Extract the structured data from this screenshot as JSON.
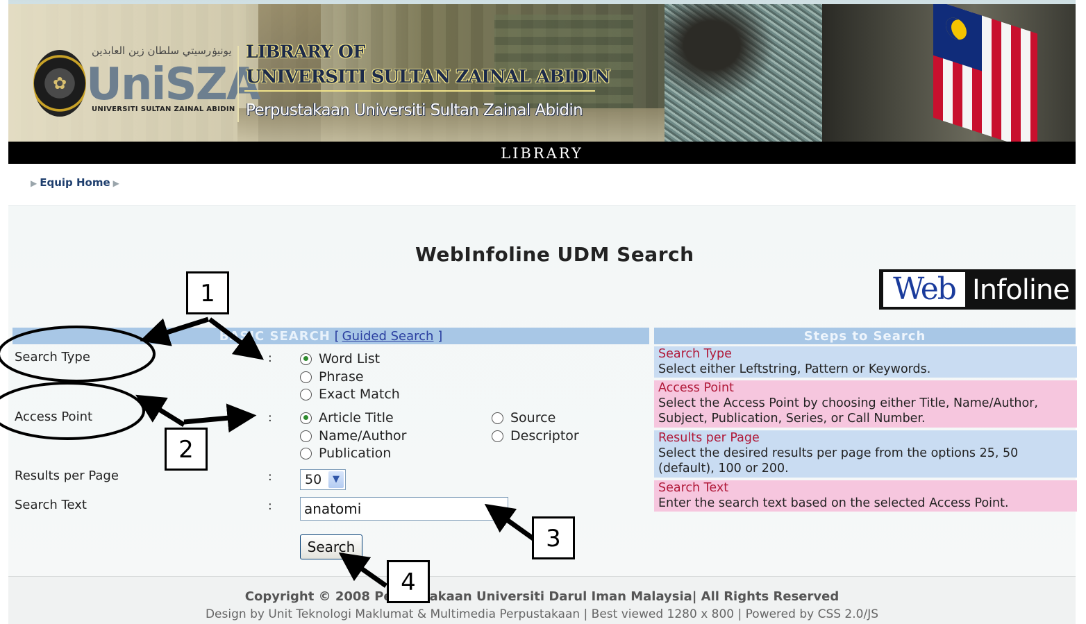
{
  "banner": {
    "arabic_text": "يونيۏرسيتي سلطان زين العابدين",
    "logo_text": "UniSZA",
    "logo_subtitle": "UNIVERSITI SULTAN ZAINAL ABIDIN",
    "title_line1": "LIBRARY OF",
    "title_line2": "UNIVERSITI SULTAN ZAINAL ABIDIN",
    "subtitle": "Perpustakaan Universiti Sultan Zainal Abidin",
    "bar_label": "LIBRARY"
  },
  "breadcrumb": {
    "home": "Equip Home"
  },
  "page": {
    "title": "WebInfoline UDM Search"
  },
  "webinfoline_logo": {
    "web": "Web",
    "infoline": "Infoline"
  },
  "basic_search": {
    "header_basic": "BASIC SEARCH",
    "header_guided": "Guided Search",
    "bracket_open": "[",
    "bracket_close": "]",
    "colon": ":",
    "search_type": {
      "label": "Search Type",
      "options": [
        "Word List",
        "Phrase",
        "Exact Match"
      ],
      "selected": "Word List"
    },
    "access_point": {
      "label": "Access Point",
      "options": [
        "Article Title",
        "Name/Author",
        "Publication",
        "Source",
        "Descriptor"
      ],
      "selected": "Article Title"
    },
    "results_per_page": {
      "label": "Results per Page",
      "value": "50"
    },
    "search_text": {
      "label": "Search Text",
      "value": "anatomi"
    },
    "search_button": "Search"
  },
  "steps": {
    "header": "Steps to Search",
    "items": [
      {
        "title": "Search Type",
        "text": "Select either Leftstring, Pattern or Keywords."
      },
      {
        "title": "Access Point",
        "text": "Select the Access Point by choosing either Title, Name/Author, Subject, Publication, Series, or Call Number."
      },
      {
        "title": "Results per Page",
        "text": "Select the desired results per page from the options 25, 50 (default), 100 or 200."
      },
      {
        "title": "Search Text",
        "text": "Enter the search text based on the selected Access Point."
      }
    ]
  },
  "footer": {
    "copyright": "Copyright © 2008 Perpustakaan Universiti Darul Iman Malaysia| All Rights Reserved",
    "design": "Design by Unit Teknologi Maklumat & Multimedia Perpustakaan | Best viewed 1280 x 800 | Powered by CSS 2.0/JS"
  },
  "annotations": {
    "labels": [
      "1",
      "2",
      "3",
      "4"
    ]
  },
  "colors": {
    "panel_header": "#a8c7e6",
    "step_blue": "#c9dcf2",
    "step_pink": "#f6c6de",
    "step_title": "#b01838",
    "link": "#2a3fa0"
  }
}
